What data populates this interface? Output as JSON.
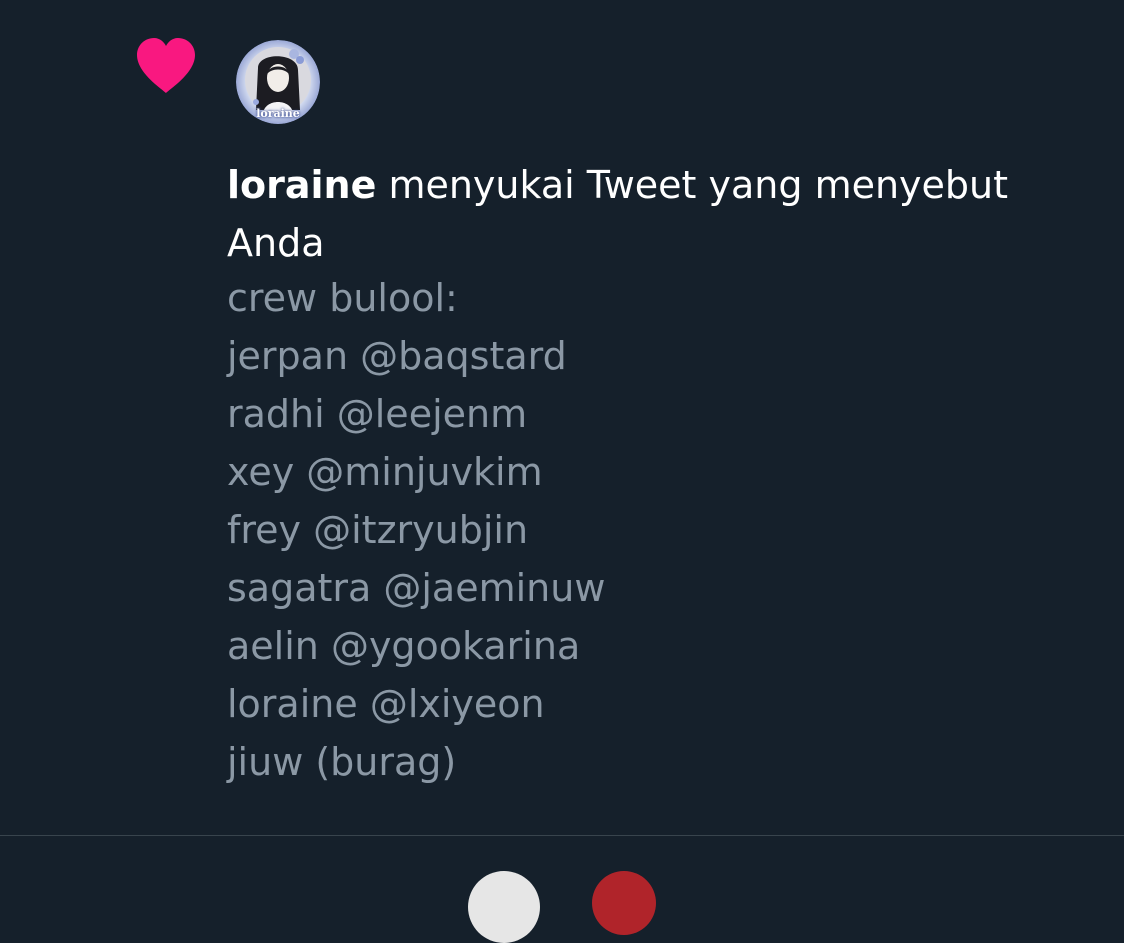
{
  "notification": {
    "icon": "heart-icon",
    "icon_color": "#f91880",
    "avatar_label": "loraine",
    "user_name": "loraine",
    "action_text": " menyukai Tweet yang menyebut Anda",
    "tweet_lines": [
      "crew bulool:",
      "jerpan @baqstard",
      "radhi @leejenm",
      "xey @minjuvkim",
      "frey @itzryubjin",
      "sagatra @jaeminuw",
      "aelin @ygookarina",
      "loraine @lxiyeon",
      "jiuw (burag)"
    ]
  },
  "colors": {
    "background": "#15202b",
    "primary_text": "#ffffff",
    "secondary_text": "#8b98a5",
    "divider": "#38444d"
  }
}
